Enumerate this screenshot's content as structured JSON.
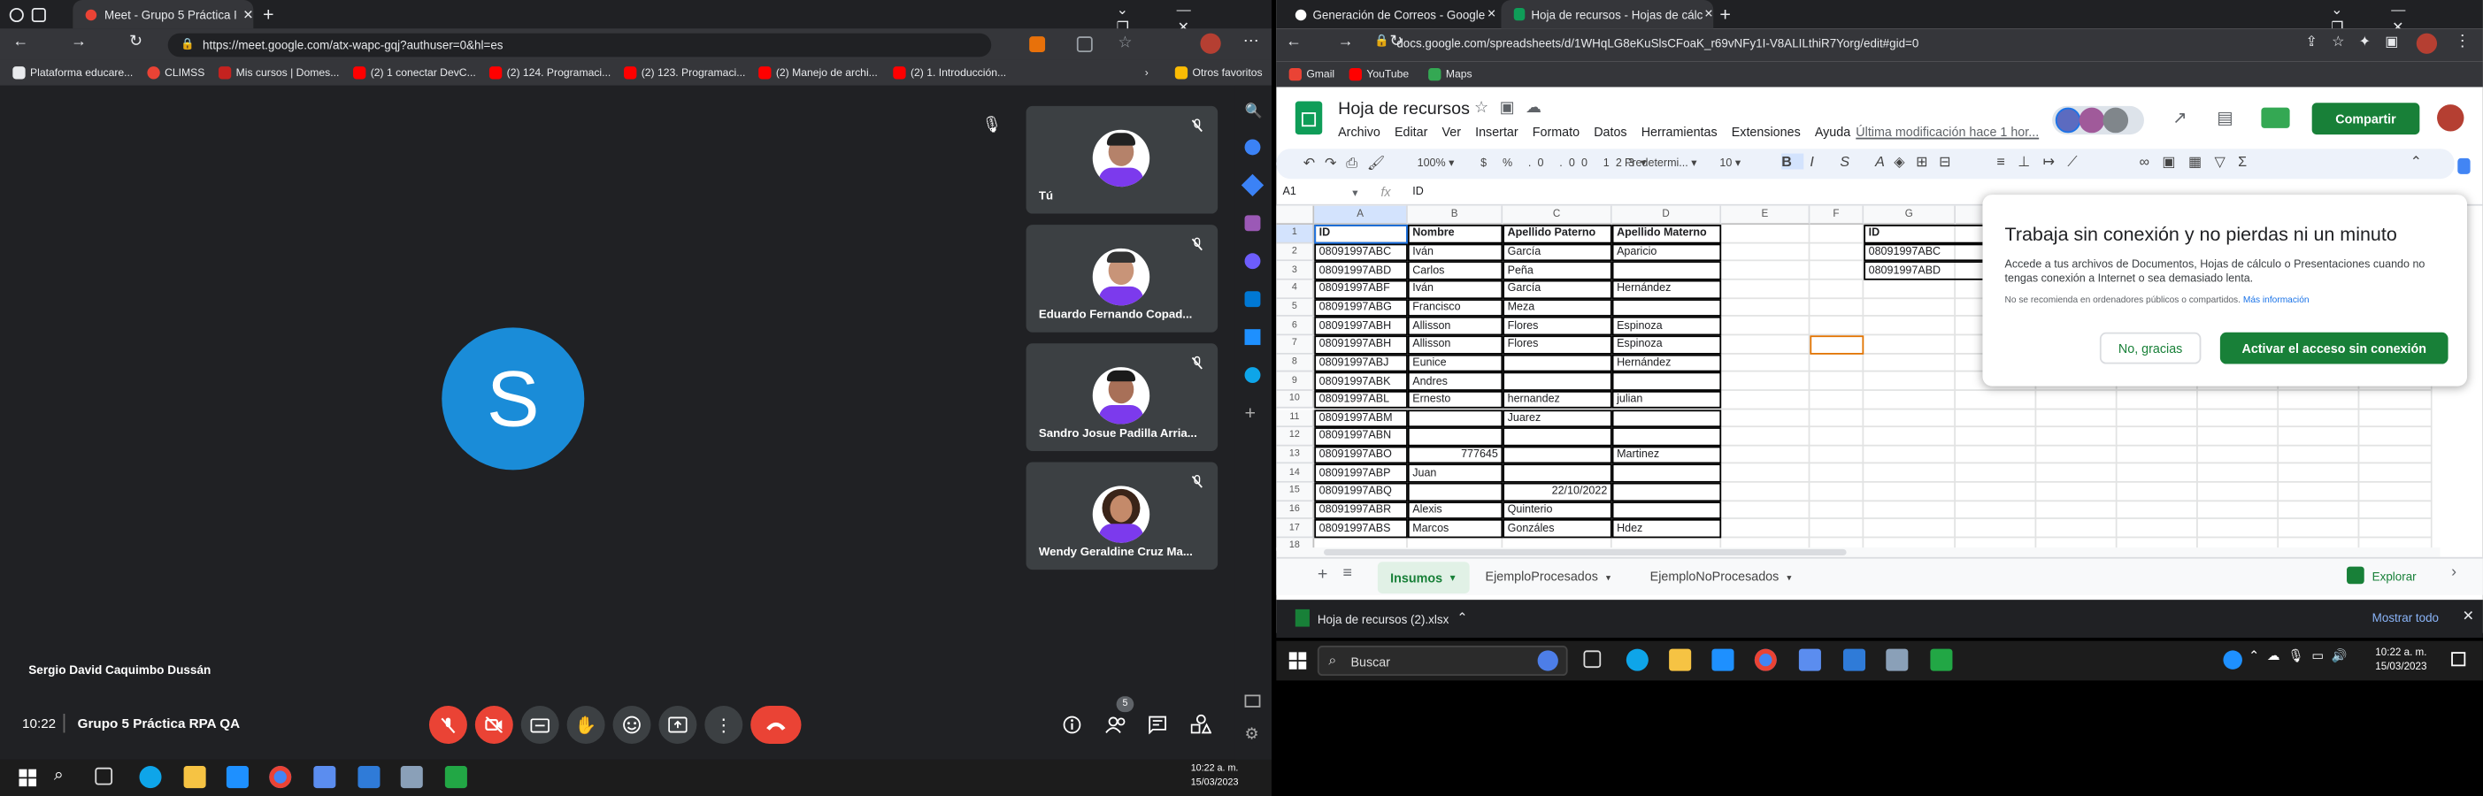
{
  "left_browser": {
    "tab_title": "Meet - Grupo 5 Práctica RPA QA",
    "url": "https://meet.google.com/atx-wapc-gqj?authuser=0&hl=es",
    "bookmarks": [
      "Plataforma educare...",
      "CLIMSS",
      "Mis cursos | Domes...",
      "(2) 1 conectar DevC...",
      "(2) 124. Programaci...",
      "(2) 123. Programaci...",
      "(2) Manejo de archi...",
      "(2) 1. Introducción..."
    ],
    "other_bookmarks": "Otros favoritos"
  },
  "meet": {
    "main_avatar_letter": "S",
    "main_avatar_color": "#1a8cd8",
    "speaker_name": "Sergio David Caquimbo Dussán",
    "participants": [
      {
        "name": "Tú"
      },
      {
        "name": "Eduardo Fernando Copad..."
      },
      {
        "name": "Sandro Josue Padilla Arria..."
      },
      {
        "name": "Wendy Geraldine Cruz Ma..."
      }
    ],
    "time": "10:22",
    "meeting_name": "Grupo 5 Práctica RPA QA",
    "people_count": "5",
    "leave_color": "#ea4335"
  },
  "right_browser": {
    "tabs": [
      "Generación de Correos - Google",
      "Hoja de recursos - Hojas de cálc"
    ],
    "url": "docs.google.com/spreadsheets/d/1WHqLG8eKuSlsCFoaK_r69vNFy1I-V8ALILthiR7Yorg/edit#gid=0",
    "bookmarks": [
      "Gmail",
      "YouTube",
      "Maps"
    ]
  },
  "sheet": {
    "title": "Hoja de recursos",
    "menu": [
      "Archivo",
      "Editar",
      "Ver",
      "Insertar",
      "Formato",
      "Datos",
      "Herramientas",
      "Extensiones",
      "Ayuda"
    ],
    "last_edit": "Última modificación hace 1 hor...",
    "share": "Compartir",
    "zoom": "100%",
    "font": "Predetermi...",
    "font_size": "10",
    "cell_ref": "A1",
    "formula": "ID",
    "columns": [
      "A",
      "B",
      "C",
      "D",
      "E",
      "F",
      "G"
    ],
    "headers": [
      "ID",
      "Nombre",
      "Apellido Paterno",
      "Apellido Materno"
    ],
    "rows": [
      [
        "08091997ABC",
        "Iván",
        "García",
        "Aparicio"
      ],
      [
        "08091997ABD",
        "Carlos",
        "Peña",
        ""
      ],
      [
        "08091997ABF",
        "Iván",
        "García",
        "Hernández"
      ],
      [
        "08091997ABG",
        "Francisco",
        "Meza",
        ""
      ],
      [
        "08091997ABH",
        "Allisson",
        "Flores",
        "Espinoza"
      ],
      [
        "08091997ABH",
        "Allisson",
        "Flores",
        "Espinoza"
      ],
      [
        "08091997ABJ",
        "Eunice",
        "",
        "Hernández"
      ],
      [
        "08091997ABK",
        "Andres",
        "",
        ""
      ],
      [
        "08091997ABL",
        "Ernesto",
        "hernandez",
        "julian"
      ],
      [
        "08091997ABM",
        "",
        "Juarez",
        ""
      ],
      [
        "08091997ABN",
        "",
        "",
        ""
      ],
      [
        "08091997ABO",
        "777645",
        "",
        "Martinez"
      ],
      [
        "08091997ABP",
        "Juan",
        "",
        ""
      ],
      [
        "08091997ABQ",
        "",
        "22/10/2022",
        ""
      ],
      [
        "08091997ABR",
        "Alexis",
        "Quinterio",
        ""
      ],
      [
        "08091997ABS",
        "Marcos",
        "Gonzáles",
        "Hdez"
      ]
    ],
    "g_column": [
      "ID",
      "08091997ABC",
      "08091997ABD"
    ],
    "sheet_tabs": [
      "Insumos",
      "EjemploProcesados",
      "EjemploNoProcesados"
    ],
    "explore": "Explorar",
    "popup": {
      "title": "Trabaja sin conexión y no pierdas ni un minuto",
      "body": "Accede a tus archivos de Documentos, Hojas de cálculo o Presentaciones cuando no tengas conexión a Internet o sea demasiado lenta.",
      "note": "No se recomienda en ordenadores públicos o compartidos.",
      "link": "Más información",
      "no_button": "No, gracias",
      "yes_button": "Activar el acceso sin conexión"
    }
  },
  "download": {
    "file": "Hoja de recursos (2).xlsx",
    "show_all": "Mostrar todo"
  },
  "taskbar": {
    "search": "Buscar",
    "time": "10:22 a. m.",
    "date": "15/03/2023"
  }
}
